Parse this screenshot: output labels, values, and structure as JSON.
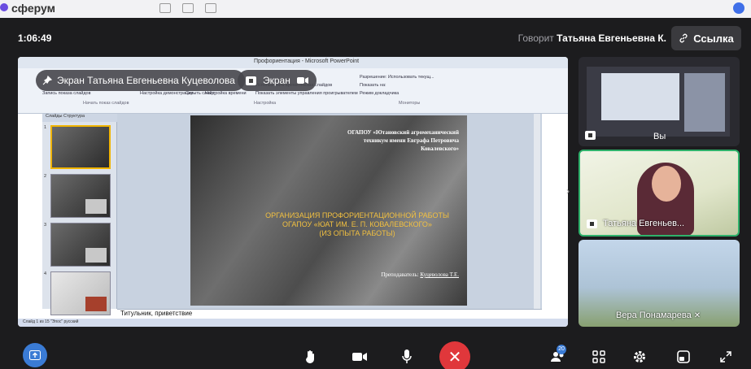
{
  "browser": {
    "brand": "сферум"
  },
  "header": {
    "timer": "1:06:49",
    "speaker_prefix": "Говорит",
    "speaker_name": "Татьяна Евгеньевна К.",
    "link_label": "Ссылка"
  },
  "share": {
    "presenter_label": "Экран Татьяна Евгеньевна Куцеволова",
    "screen_label": "Экран",
    "ppt_title": "Профориентация - Microsoft PowerPoint",
    "ribbon_items": [
      "Использовать время показа слайдов",
      "Показать элементы управления проигрывателем",
      "Разрешение: Использовать текущ...",
      "Показать на:",
      "Режим докладчика",
      "Мониторы",
      "Настройка",
      "Начать показ слайдов",
      "Настройка демонстрации",
      "Скрыть слайд",
      "Настройка времени",
      "Запись показа слайдов"
    ],
    "slide_tabs": "Слайды   Структура",
    "slides": [
      {
        "number": "1"
      },
      {
        "number": "2"
      },
      {
        "number": "3"
      },
      {
        "number": "4"
      }
    ],
    "slide_org": "ОГАПОУ «Ютановский агромеханический техникум имени Евграфа Петровича Ковалевского»",
    "slide_heading_1": "ОРГАНИЗАЦИЯ ПРОФОРИЕНТАЦИОННОЙ РАБОТЫ",
    "slide_heading_2": "ОГАПОУ «ЮАТ ИМ. Е. П. КОВАЛЕВСКОГО»",
    "slide_heading_3": "(ИЗ ОПЫТА РАБОТЫ)",
    "slide_author_prefix": "Преподаватель:",
    "slide_author_name": "Куцеволова Т.Е.",
    "notes": "Титульник, приветствие",
    "status": "Слайд 1 из 15   \"Эпос\"   русский"
  },
  "participants": [
    {
      "label": "Вы"
    },
    {
      "label": "Татьяна Евгеньев..."
    },
    {
      "label": "Вера Понамарева"
    }
  ],
  "controls": {
    "participants_count": "20",
    "accent_color": "#3a7bd5",
    "hangup_color": "#e0373b"
  }
}
